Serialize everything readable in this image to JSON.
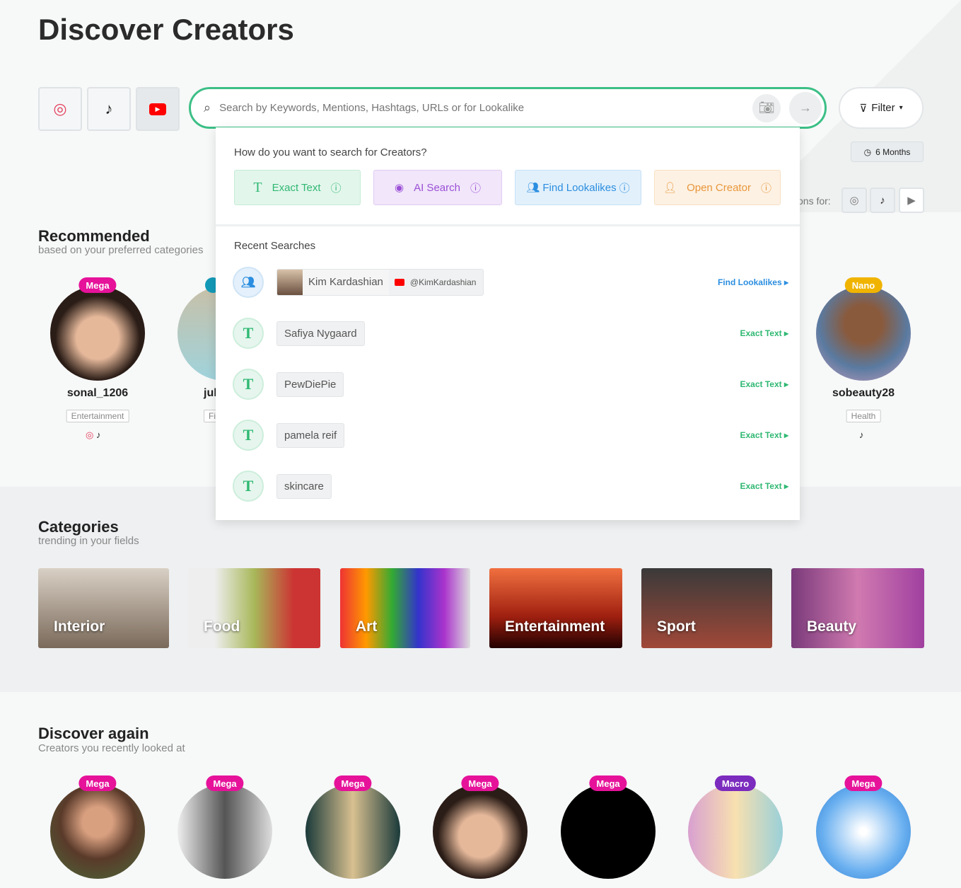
{
  "page": {
    "title": "Discover Creators"
  },
  "platforms": [
    {
      "icon": "instagram-icon"
    },
    {
      "icon": "tiktok-icon"
    },
    {
      "icon": "youtube-icon"
    }
  ],
  "search": {
    "placeholder": "Search by Keywords, Mentions, Hashtags, URLs or for Lookalike",
    "value": ""
  },
  "filter": {
    "label": "Filter"
  },
  "time_range": {
    "label": "6 Months"
  },
  "suggestions_for": {
    "label": "ons for:"
  },
  "dropdown": {
    "question": "How do you want to search for Creators?",
    "modes": [
      {
        "label": "Exact Text",
        "color": "#2fb872"
      },
      {
        "label": "AI Search",
        "color": "#9b4fd6"
      },
      {
        "label": "Find Lookalikes",
        "color": "#2b8ee0"
      },
      {
        "label": "Open Creator",
        "color": "#e8963a"
      }
    ],
    "recent_title": "Recent Searches",
    "recent": [
      {
        "type": "lookalike",
        "name": "Kim Kardashian",
        "handle": "@KimKardashian",
        "action": "Find Lookalikes"
      },
      {
        "type": "text",
        "name": "Safiya Nygaard",
        "action": "Exact Text"
      },
      {
        "type": "text",
        "name": "PewDiePie",
        "action": "Exact Text"
      },
      {
        "type": "text",
        "name": "pamela reif",
        "action": "Exact Text"
      },
      {
        "type": "text",
        "name": "skincare",
        "action": "Exact Text"
      }
    ]
  },
  "recommended": {
    "title": "Recommended",
    "subtitle": "based on your preferred categories",
    "creators": [
      {
        "badge": "Mega",
        "name": "sonal_1206",
        "category": "Entertainment"
      },
      {
        "badge": "",
        "name": "juh",
        "category": "Fi"
      },
      {
        "badge": "Nano",
        "name": "sobeauty28",
        "category": "Health"
      }
    ]
  },
  "categories": {
    "title": "Categories",
    "subtitle": "trending in your fields",
    "items": [
      "Interior",
      "Food",
      "Art",
      "Entertainment",
      "Sport",
      "Beauty"
    ]
  },
  "discover_again": {
    "title": "Discover again",
    "subtitle": "Creators you recently looked at",
    "badges": [
      "Mega",
      "Mega",
      "Mega",
      "Mega",
      "Mega",
      "Macro",
      "Mega"
    ]
  },
  "colors": {
    "accent": "#3cbf86",
    "mega": "#e6129a",
    "macro": "#7b2bbd",
    "nano": "#f0b400"
  }
}
